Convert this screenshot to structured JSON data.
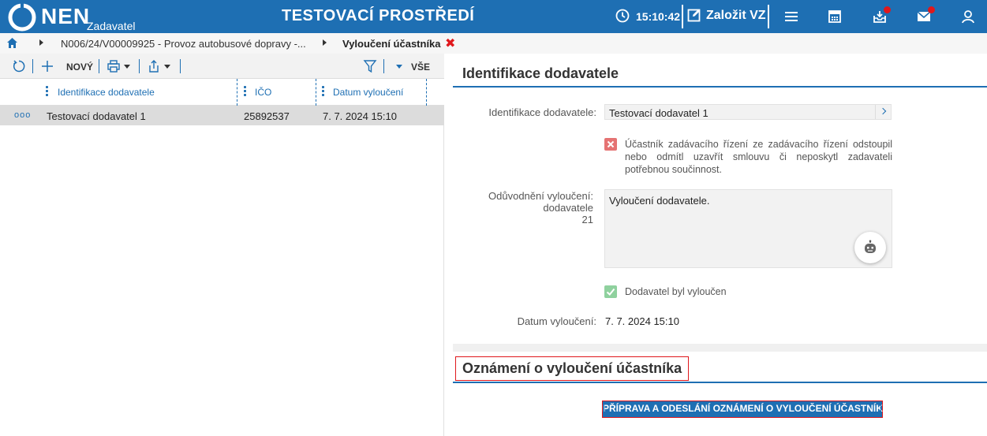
{
  "header": {
    "brand": "NEN",
    "brand_sub": "Zadavatel",
    "env_title": "TESTOVACÍ PROSTŘEDÍ",
    "time": "15:10:42",
    "create_label": "Založit VZ",
    "accent_color": "#1e6fb3",
    "notification_color": "#e0181c",
    "icons": [
      "clock-icon",
      "edit-icon",
      "menu-icon",
      "calculator-icon",
      "inbox-icon",
      "mail-icon",
      "user-icon"
    ]
  },
  "breadcrumb": {
    "items": [
      "N006/24/V00009925 - Provoz autobusové dopravy -...",
      "Vyloučení účastníka"
    ],
    "close_symbol": "✖"
  },
  "toolbar": {
    "new_label": "NOVÝ",
    "filter_all_label": "VŠE",
    "icons": [
      "refresh-icon",
      "plus-icon",
      "print-icon",
      "export-icon",
      "filter-icon"
    ]
  },
  "grid": {
    "columns": [
      "Identifikace dodavatele",
      "IČO",
      "Datum vyloučení"
    ],
    "rows": [
      {
        "menu": "ooo",
        "cells": [
          "Testovací dodavatel 1",
          "25892537",
          "7. 7. 2024 15:10"
        ]
      }
    ]
  },
  "detail": {
    "section_title": "Identifikace dodavatele",
    "supplier_label": "Identifikace dodavatele:",
    "supplier_value": "Testovací dodavatel 1",
    "withdrew_text": "Účastník zadávacího řízení ze zadávacího řízení odstoupil nebo odmítl uzavřít smlouvu či neposkytl zadavateli potřebnou součinnost.",
    "withdrew_checked": false,
    "reason_label_line1": "Odůvodnění vyloučení:",
    "reason_label_line2": "dodavatele",
    "reason_label_line3": "21",
    "reason_value": "Vyloučení dodavatele.",
    "excluded_label": "Dodavatel byl vyloučen",
    "excluded_checked": true,
    "date_label": "Datum vyloučení:",
    "date_value": "7. 7. 2024 15:10"
  },
  "notice": {
    "title": "Oznámení o vyloučení účastníka",
    "button_label": "PŘÍPRAVA A ODESLÁNÍ OZNÁMENÍ O VYLOUČENÍ ÚČASTNÍKA"
  }
}
